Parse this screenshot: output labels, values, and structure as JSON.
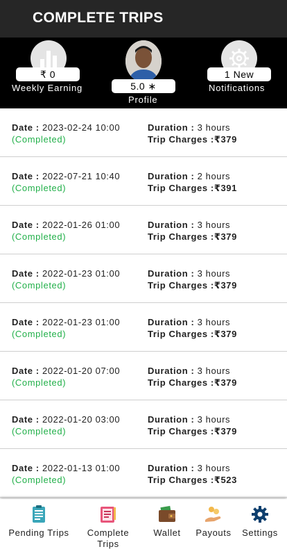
{
  "titlebar": {
    "title": "COMPLETE TRIPS"
  },
  "header": {
    "weekly": {
      "value": "₹ 0",
      "label": "Weekly Earning",
      "icon": "bar-chart-icon"
    },
    "profile": {
      "rating": "5.0 ∗",
      "label": "Profile"
    },
    "notifications": {
      "value": "1 New",
      "label": "Notifications",
      "icon": "gear-icon"
    }
  },
  "trips": [
    {
      "date_label": "Date : ",
      "date": "2023-02-24 10:00",
      "status": "(Completed)",
      "duration_label": "Duration : ",
      "duration": "3 hours",
      "charges_label": "Trip Charges :",
      "charges": "₹379"
    },
    {
      "date_label": "Date : ",
      "date": "2022-07-21 10:40",
      "status": "(Completed)",
      "duration_label": "Duration : ",
      "duration": "2 hours",
      "charges_label": "Trip Charges :",
      "charges": "₹391"
    },
    {
      "date_label": "Date : ",
      "date": "2022-01-26 01:00",
      "status": "(Completed)",
      "duration_label": "Duration : ",
      "duration": "3 hours",
      "charges_label": "Trip Charges :",
      "charges": "₹379"
    },
    {
      "date_label": "Date : ",
      "date": "2022-01-23 01:00",
      "status": "(Completed)",
      "duration_label": "Duration : ",
      "duration": "3 hours",
      "charges_label": "Trip Charges :",
      "charges": "₹379"
    },
    {
      "date_label": "Date : ",
      "date": "2022-01-23 01:00",
      "status": "(Completed)",
      "duration_label": "Duration : ",
      "duration": "3 hours",
      "charges_label": "Trip Charges :",
      "charges": "₹379"
    },
    {
      "date_label": "Date : ",
      "date": "2022-01-20 07:00",
      "status": "(Completed)",
      "duration_label": "Duration : ",
      "duration": "3 hours",
      "charges_label": "Trip Charges :",
      "charges": "₹379"
    },
    {
      "date_label": "Date : ",
      "date": "2022-01-20 03:00",
      "status": "(Completed)",
      "duration_label": "Duration : ",
      "duration": "3 hours",
      "charges_label": "Trip Charges :",
      "charges": "₹379"
    },
    {
      "date_label": "Date : ",
      "date": "2022-01-13 01:00",
      "status": "(Completed)",
      "duration_label": "Duration : ",
      "duration": "3 hours",
      "charges_label": "Trip Charges :",
      "charges": "₹523"
    }
  ],
  "nav": [
    {
      "label": "Pending Trips",
      "icon": "clipboard-list-icon"
    },
    {
      "label": "Complete\nTrips",
      "icon": "checklist-icon"
    },
    {
      "label": "Wallet",
      "icon": "wallet-icon"
    },
    {
      "label": "Payouts",
      "icon": "coins-hand-icon"
    },
    {
      "label": "Settings",
      "icon": "gear-icon"
    }
  ],
  "colors": {
    "completed": "#22b04a",
    "header_bg": "#000000",
    "titlebar_bg": "#262626"
  }
}
